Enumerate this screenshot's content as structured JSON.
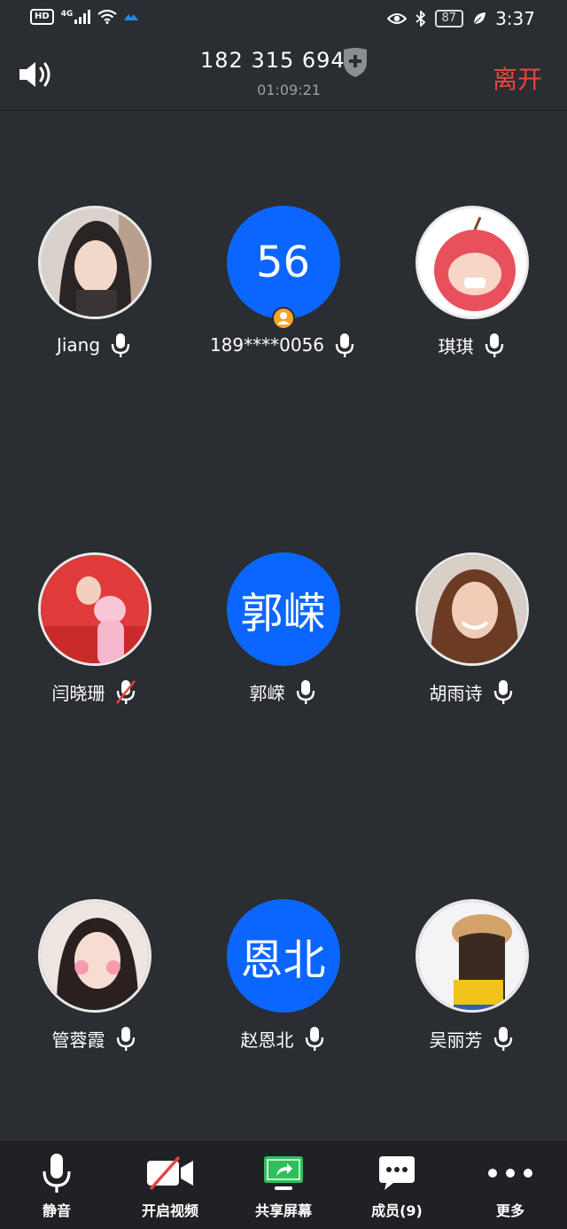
{
  "status_bar": {
    "network_badge": "HD",
    "signal_type": "4G",
    "battery": "87",
    "time": "3:37",
    "icons": [
      "hd-icon",
      "signal-icon",
      "wifi-icon",
      "app-icon",
      "eye-icon",
      "bluetooth-icon",
      "battery-icon",
      "leaf-icon"
    ]
  },
  "header": {
    "meeting_id": "182 315 694",
    "duration": "01:09:21",
    "leave_label": "离开",
    "leave_color": "#f0443f"
  },
  "participants": [
    {
      "name": "Jiang",
      "avatar_type": "photo",
      "muted": false
    },
    {
      "name": "189****0056",
      "avatar_type": "initials",
      "initials": "56",
      "host": true,
      "muted": false
    },
    {
      "name": "琪琪",
      "avatar_type": "photo",
      "muted": false
    },
    {
      "name": "闫晓珊",
      "avatar_type": "photo",
      "muted": true
    },
    {
      "name": "郭嵘",
      "avatar_type": "initials",
      "initials": "郭嵘",
      "muted": false
    },
    {
      "name": "胡雨诗",
      "avatar_type": "photo",
      "muted": false
    },
    {
      "name": "管蓉霞",
      "avatar_type": "photo",
      "muted": false
    },
    {
      "name": "赵恩北",
      "avatar_type": "initials",
      "initials": "恩北",
      "muted": false
    },
    {
      "name": "吴丽芳",
      "avatar_type": "photo",
      "muted": false
    }
  ],
  "toolbar": {
    "mute_label": "静音",
    "video_label": "开启视频",
    "share_label": "共享屏幕",
    "members_label": "成员(9)",
    "more_label": "更多"
  },
  "colors": {
    "background": "#2a2d31",
    "avatar_blue": "#0a66ff",
    "share_green": "#2fbf5a",
    "leave_red": "#f0443f"
  }
}
